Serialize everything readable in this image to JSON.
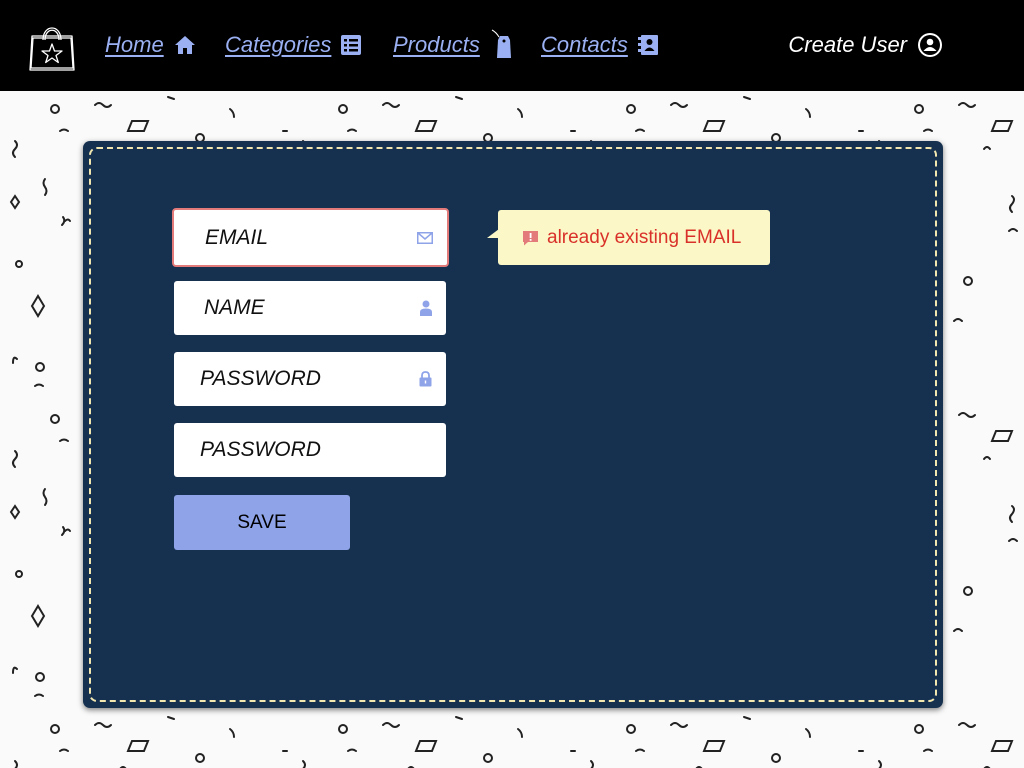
{
  "nav": {
    "logo_icon": "shopping-bag-star-icon",
    "links": [
      {
        "label": "Home",
        "icon": "home-icon"
      },
      {
        "label": "Categories",
        "icon": "list-icon"
      },
      {
        "label": "Products",
        "icon": "tag-icon"
      },
      {
        "label": "Contacts",
        "icon": "address-book-icon"
      }
    ],
    "create_user": {
      "label": "Create User",
      "icon": "user-circle-icon"
    }
  },
  "form": {
    "email_placeholder": "EMAIL",
    "name_placeholder": "NAME",
    "password_placeholder": "PASSWORD",
    "password_confirm_placeholder": "PASSWORD",
    "save_label": "SAVE",
    "error_message": "already existing EMAIL"
  },
  "colors": {
    "nav_bg": "#000000",
    "nav_link": "#9ab0f2",
    "panel_bg": "#163150",
    "panel_border": "#f3e7b0",
    "error_border": "#e37b7b",
    "error_text": "#d9312a",
    "tooltip_bg": "#fbf7c6",
    "button_bg": "#8fa3e8",
    "icon_color": "#8fa3e8"
  }
}
